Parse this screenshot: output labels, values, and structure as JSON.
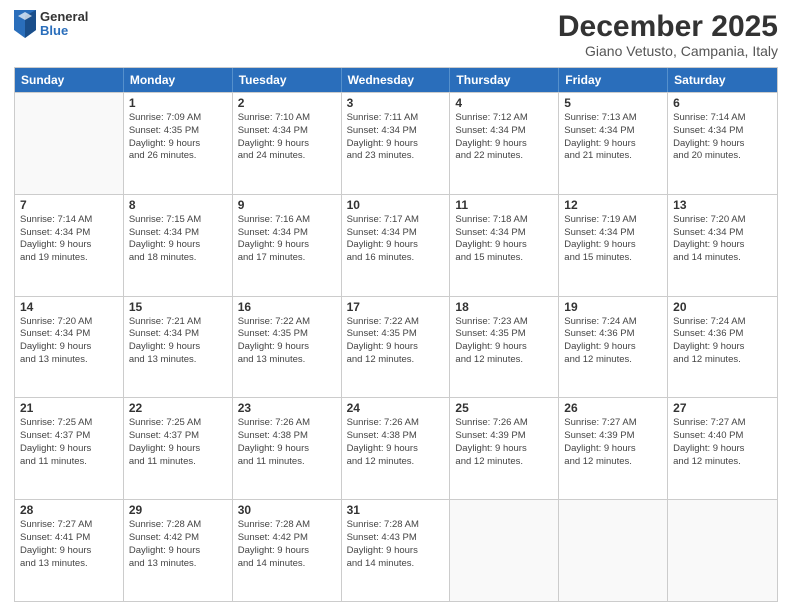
{
  "header": {
    "logo_general": "General",
    "logo_blue": "Blue",
    "month_title": "December 2025",
    "location": "Giano Vetusto, Campania, Italy"
  },
  "days_of_week": [
    "Sunday",
    "Monday",
    "Tuesday",
    "Wednesday",
    "Thursday",
    "Friday",
    "Saturday"
  ],
  "weeks": [
    [
      {
        "day": "",
        "info": ""
      },
      {
        "day": "1",
        "info": "Sunrise: 7:09 AM\nSunset: 4:35 PM\nDaylight: 9 hours\nand 26 minutes."
      },
      {
        "day": "2",
        "info": "Sunrise: 7:10 AM\nSunset: 4:34 PM\nDaylight: 9 hours\nand 24 minutes."
      },
      {
        "day": "3",
        "info": "Sunrise: 7:11 AM\nSunset: 4:34 PM\nDaylight: 9 hours\nand 23 minutes."
      },
      {
        "day": "4",
        "info": "Sunrise: 7:12 AM\nSunset: 4:34 PM\nDaylight: 9 hours\nand 22 minutes."
      },
      {
        "day": "5",
        "info": "Sunrise: 7:13 AM\nSunset: 4:34 PM\nDaylight: 9 hours\nand 21 minutes."
      },
      {
        "day": "6",
        "info": "Sunrise: 7:14 AM\nSunset: 4:34 PM\nDaylight: 9 hours\nand 20 minutes."
      }
    ],
    [
      {
        "day": "7",
        "info": "Sunrise: 7:14 AM\nSunset: 4:34 PM\nDaylight: 9 hours\nand 19 minutes."
      },
      {
        "day": "8",
        "info": "Sunrise: 7:15 AM\nSunset: 4:34 PM\nDaylight: 9 hours\nand 18 minutes."
      },
      {
        "day": "9",
        "info": "Sunrise: 7:16 AM\nSunset: 4:34 PM\nDaylight: 9 hours\nand 17 minutes."
      },
      {
        "day": "10",
        "info": "Sunrise: 7:17 AM\nSunset: 4:34 PM\nDaylight: 9 hours\nand 16 minutes."
      },
      {
        "day": "11",
        "info": "Sunrise: 7:18 AM\nSunset: 4:34 PM\nDaylight: 9 hours\nand 15 minutes."
      },
      {
        "day": "12",
        "info": "Sunrise: 7:19 AM\nSunset: 4:34 PM\nDaylight: 9 hours\nand 15 minutes."
      },
      {
        "day": "13",
        "info": "Sunrise: 7:20 AM\nSunset: 4:34 PM\nDaylight: 9 hours\nand 14 minutes."
      }
    ],
    [
      {
        "day": "14",
        "info": "Sunrise: 7:20 AM\nSunset: 4:34 PM\nDaylight: 9 hours\nand 13 minutes."
      },
      {
        "day": "15",
        "info": "Sunrise: 7:21 AM\nSunset: 4:34 PM\nDaylight: 9 hours\nand 13 minutes."
      },
      {
        "day": "16",
        "info": "Sunrise: 7:22 AM\nSunset: 4:35 PM\nDaylight: 9 hours\nand 13 minutes."
      },
      {
        "day": "17",
        "info": "Sunrise: 7:22 AM\nSunset: 4:35 PM\nDaylight: 9 hours\nand 12 minutes."
      },
      {
        "day": "18",
        "info": "Sunrise: 7:23 AM\nSunset: 4:35 PM\nDaylight: 9 hours\nand 12 minutes."
      },
      {
        "day": "19",
        "info": "Sunrise: 7:24 AM\nSunset: 4:36 PM\nDaylight: 9 hours\nand 12 minutes."
      },
      {
        "day": "20",
        "info": "Sunrise: 7:24 AM\nSunset: 4:36 PM\nDaylight: 9 hours\nand 12 minutes."
      }
    ],
    [
      {
        "day": "21",
        "info": "Sunrise: 7:25 AM\nSunset: 4:37 PM\nDaylight: 9 hours\nand 11 minutes."
      },
      {
        "day": "22",
        "info": "Sunrise: 7:25 AM\nSunset: 4:37 PM\nDaylight: 9 hours\nand 11 minutes."
      },
      {
        "day": "23",
        "info": "Sunrise: 7:26 AM\nSunset: 4:38 PM\nDaylight: 9 hours\nand 11 minutes."
      },
      {
        "day": "24",
        "info": "Sunrise: 7:26 AM\nSunset: 4:38 PM\nDaylight: 9 hours\nand 12 minutes."
      },
      {
        "day": "25",
        "info": "Sunrise: 7:26 AM\nSunset: 4:39 PM\nDaylight: 9 hours\nand 12 minutes."
      },
      {
        "day": "26",
        "info": "Sunrise: 7:27 AM\nSunset: 4:39 PM\nDaylight: 9 hours\nand 12 minutes."
      },
      {
        "day": "27",
        "info": "Sunrise: 7:27 AM\nSunset: 4:40 PM\nDaylight: 9 hours\nand 12 minutes."
      }
    ],
    [
      {
        "day": "28",
        "info": "Sunrise: 7:27 AM\nSunset: 4:41 PM\nDaylight: 9 hours\nand 13 minutes."
      },
      {
        "day": "29",
        "info": "Sunrise: 7:28 AM\nSunset: 4:42 PM\nDaylight: 9 hours\nand 13 minutes."
      },
      {
        "day": "30",
        "info": "Sunrise: 7:28 AM\nSunset: 4:42 PM\nDaylight: 9 hours\nand 14 minutes."
      },
      {
        "day": "31",
        "info": "Sunrise: 7:28 AM\nSunset: 4:43 PM\nDaylight: 9 hours\nand 14 minutes."
      },
      {
        "day": "",
        "info": ""
      },
      {
        "day": "",
        "info": ""
      },
      {
        "day": "",
        "info": ""
      }
    ]
  ]
}
